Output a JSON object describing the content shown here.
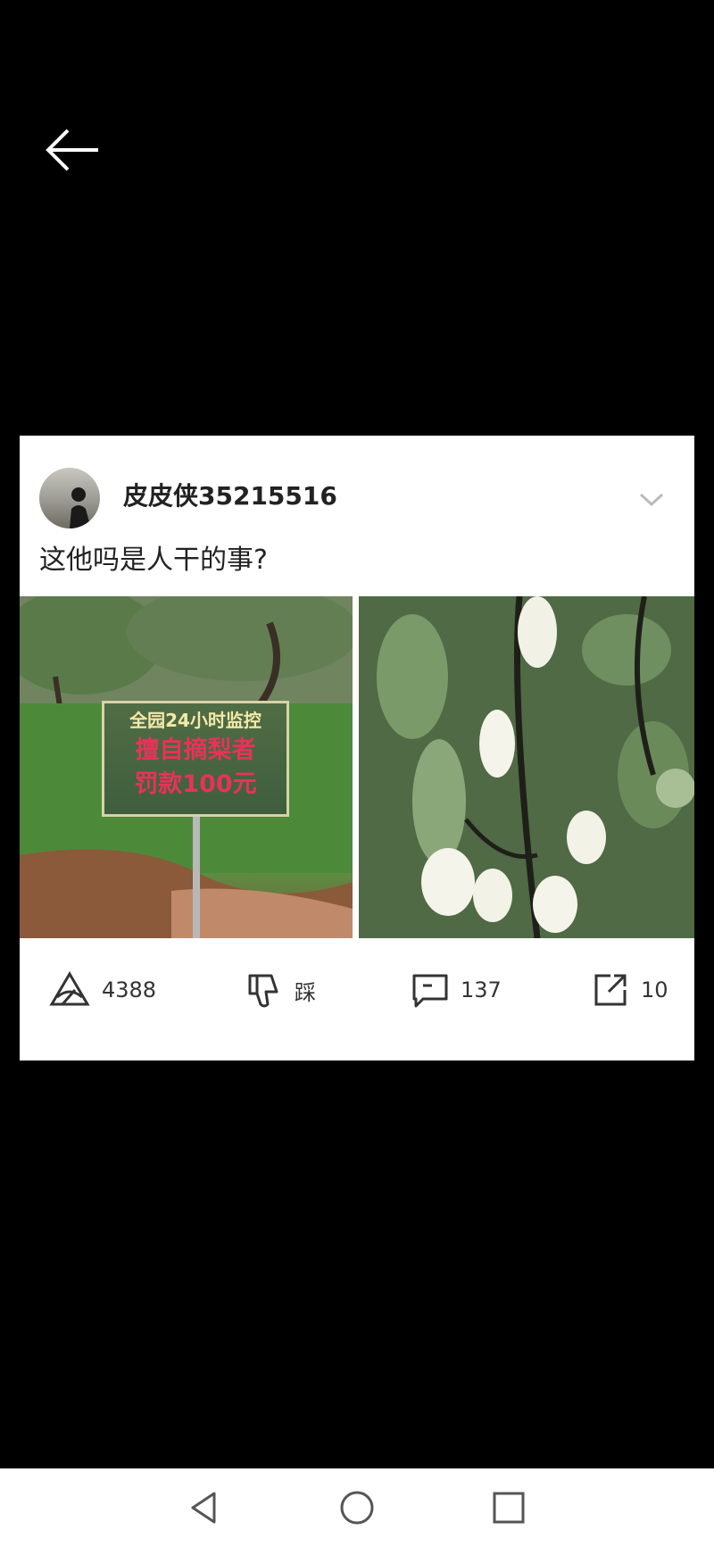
{
  "post": {
    "username": "皮皮侠35215516",
    "text": "这他吗是人干的事?"
  },
  "images": {
    "left": {
      "sign_line1": "全园24小时监控",
      "sign_line2": "擅自摘梨者",
      "sign_line3": "罚款100元"
    }
  },
  "actions": {
    "like_count": "4388",
    "dislike_label": "踩",
    "comment_count": "137",
    "share_count": "10"
  },
  "icons": {
    "back": "arrow-left-icon",
    "more": "chevron-down-icon",
    "like": "like-icon",
    "dislike": "thumbs-down-icon",
    "comment": "comment-icon",
    "share": "share-icon",
    "nav_back": "triangle-back-icon",
    "nav_home": "circle-home-icon",
    "nav_recents": "square-recents-icon"
  },
  "colors": {
    "background": "#000000",
    "card": "#ffffff",
    "text": "#222222",
    "navbar": "#ffffff"
  }
}
